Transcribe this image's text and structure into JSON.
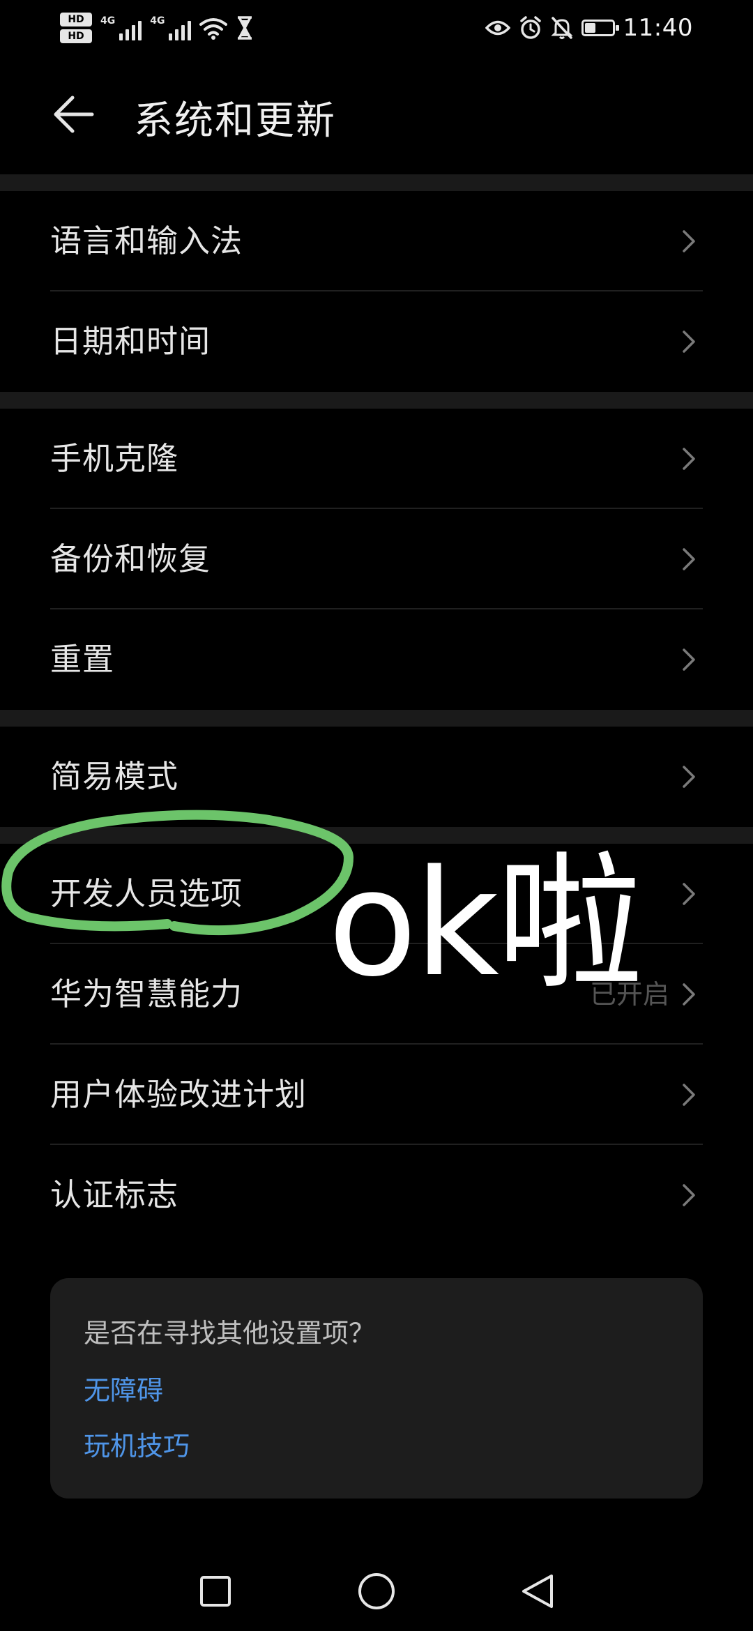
{
  "status_bar": {
    "hd_badge_1": "HD",
    "hd_badge_2": "HD",
    "signal_1_label": "4G",
    "signal_2_label": "4G",
    "time": "11:40",
    "battery_level": 0.4
  },
  "header": {
    "title": "系统和更新"
  },
  "groups": [
    {
      "items": [
        {
          "label": "语言和输入法"
        },
        {
          "label": "日期和时间"
        }
      ]
    },
    {
      "items": [
        {
          "label": "手机克隆"
        },
        {
          "label": "备份和恢复"
        },
        {
          "label": "重置"
        }
      ]
    },
    {
      "items": [
        {
          "label": "简易模式"
        }
      ]
    },
    {
      "items": [
        {
          "label": "开发人员选项"
        },
        {
          "label": "华为智慧能力",
          "value": "已开启"
        },
        {
          "label": "用户体验改进计划"
        },
        {
          "label": "认证标志"
        }
      ]
    }
  ],
  "suggestion_card": {
    "title": "是否在寻找其他设置项？",
    "links": [
      "无障碍",
      "玩机技巧"
    ]
  },
  "annotation": {
    "text": "ok啦",
    "circle_color": "#6cc46a"
  },
  "colors": {
    "background": "#000000",
    "link": "#4f95e8",
    "text": "#e6e6e6",
    "separator": "#1a1a1a"
  }
}
